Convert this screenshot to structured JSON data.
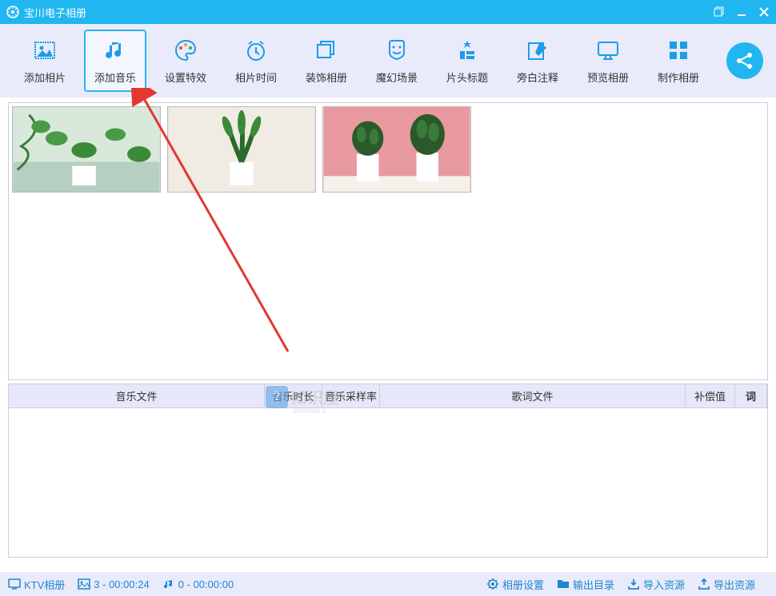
{
  "app": {
    "title": "宝川电子相册"
  },
  "toolbar": {
    "items": [
      {
        "label": "添加相片",
        "icon": "photo-icon"
      },
      {
        "label": "添加音乐",
        "icon": "music-icon"
      },
      {
        "label": "设置特效",
        "icon": "palette-icon"
      },
      {
        "label": "相片时间",
        "icon": "clock-icon"
      },
      {
        "label": "装饰相册",
        "icon": "decorate-icon"
      },
      {
        "label": "魔幻场景",
        "icon": "scene-icon"
      },
      {
        "label": "片头标题",
        "icon": "apps-icon"
      },
      {
        "label": "旁白注释",
        "icon": "edit-icon"
      },
      {
        "label": "预览相册",
        "icon": "monitor-icon"
      },
      {
        "label": "制作相册",
        "icon": "grid-icon"
      }
    ],
    "selected_index": 1
  },
  "music_table": {
    "headers": {
      "file": "音乐文件",
      "duration": "音乐时长",
      "sample": "音乐采样率",
      "lyric": "歌词文件",
      "comp": "补偿值",
      "ci": "词"
    }
  },
  "statusbar": {
    "ktv": "KTV相册",
    "photo_count": "3 - 00:00:24",
    "music_count": "0 - 00:00:00",
    "album_settings": "相册设置",
    "output_dir": "输出目录",
    "import_res": "导入资源",
    "export_res": "导出资源"
  },
  "watermark": {
    "text": "知识屋",
    "sub": "zhishiwu.c"
  }
}
